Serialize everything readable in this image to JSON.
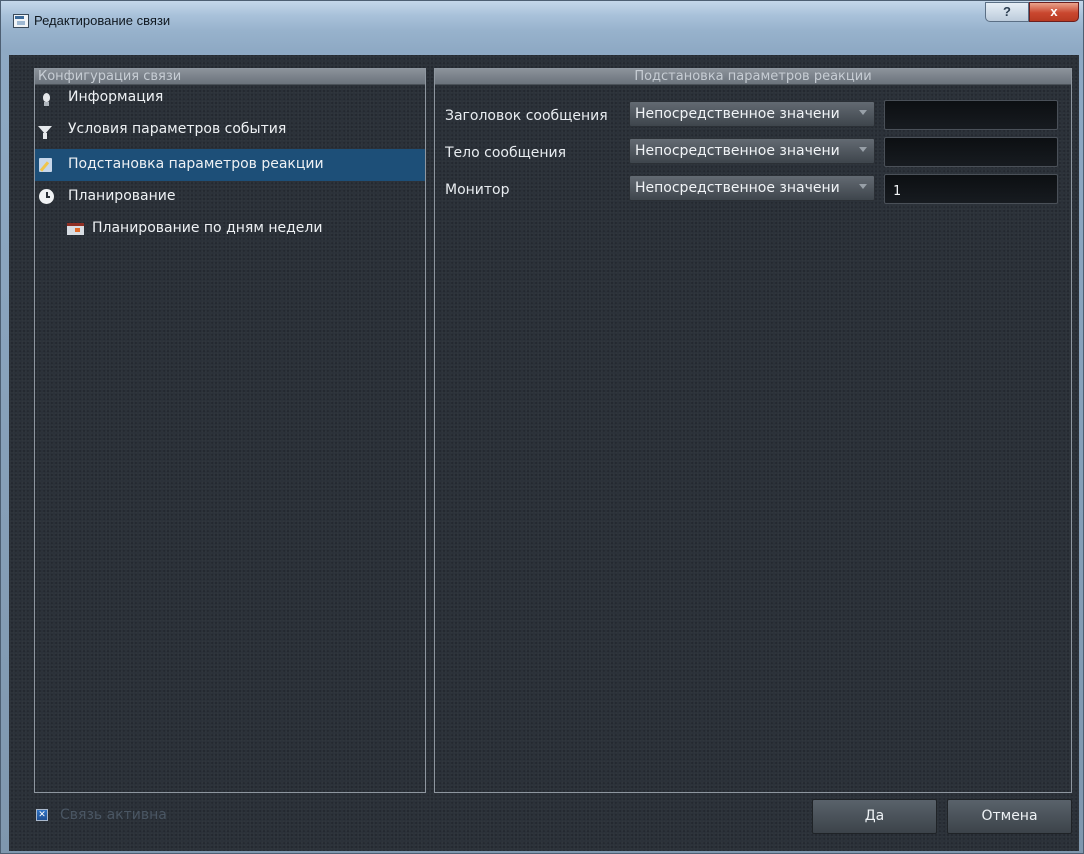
{
  "window": {
    "title": "Редактирование связи",
    "help_label": "?",
    "close_label": "x"
  },
  "left_panel": {
    "header": "Конфигурация связи",
    "items": [
      {
        "label": "Информация",
        "icon": "lightbulb-icon"
      },
      {
        "label": "Условия параметров события",
        "icon": "filter-icon"
      },
      {
        "label": "Подстановка параметров реакции",
        "icon": "edit-icon",
        "selected": true
      },
      {
        "label": "Планирование",
        "icon": "clock-icon"
      },
      {
        "label": "Планирование по дням недели",
        "icon": "calendar-icon"
      }
    ]
  },
  "right_panel": {
    "header": "Подстановка параметров реакции",
    "rows": [
      {
        "label": "Заголовок сообщения",
        "mode": "Непосредственное значени",
        "value": ""
      },
      {
        "label": "Тело сообщения",
        "mode": "Непосредственное значени",
        "value": ""
      },
      {
        "label": "Монитор",
        "mode": "Непосредственное значени",
        "value": "1"
      }
    ]
  },
  "footer": {
    "active_label": "Связь активна",
    "active_checked": true,
    "ok_label": "Да",
    "cancel_label": "Отмена"
  },
  "colors": {
    "background": "#2a3038",
    "selection": "#1d4f78",
    "close_button": "#c9472f"
  }
}
